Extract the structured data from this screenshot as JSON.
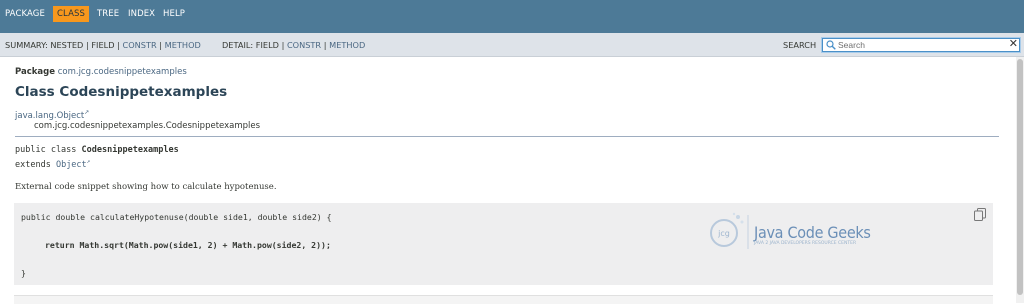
{
  "top_nav": {
    "items": [
      "PACKAGE",
      "CLASS",
      "TREE",
      "INDEX",
      "HELP"
    ],
    "active": "CLASS"
  },
  "sub_nav": {
    "summary_label": "SUMMARY:",
    "summary_items": [
      "NESTED",
      "FIELD",
      "CONSTR",
      "METHOD"
    ],
    "detail_label": "DETAIL:",
    "detail_items": [
      "FIELD",
      "CONSTR",
      "METHOD"
    ],
    "separator": "|",
    "search_label": "SEARCH",
    "search_placeholder": "Search",
    "clear_glyph": "✕"
  },
  "header": {
    "package_label": "Package",
    "package_name": "com.jcg.codesnippetexamples",
    "class_title": "Class Codesnippetexamples"
  },
  "inheritance": {
    "parent": "java.lang.Object",
    "external_glyph": "↗",
    "child": "com.jcg.codesnippetexamples.Codesnippetexamples"
  },
  "signature": {
    "line1_prefix": "public class ",
    "line1_name": "Codesnippetexamples",
    "line2_prefix": "extends ",
    "line2_link": "Object"
  },
  "description": "External code snippet showing how to calculate hypotenuse.",
  "code": {
    "line1": "public double calculateHypotenuse(double side1, double side2) {",
    "line2": "return Math.sqrt(Math.pow(side1, 2) + Math.pow(side2, 2));",
    "line3": "}"
  },
  "logo": {
    "brand": "Java Code Geeks",
    "tagline": "JAVA 2 JAVA DEVELOPERS RESOURCE CENTER",
    "monogram": "jcg"
  },
  "colors": {
    "nav_bar": "#4d7a97",
    "active_tab": "#f8981d",
    "sub_nav": "#dee3e9",
    "link": "#4a6782",
    "title": "#2c4557",
    "code_bg": "#eeeeef"
  },
  "icons": {
    "search": "magnifier-icon",
    "copy": "copy-icon",
    "clear": "close-icon"
  }
}
